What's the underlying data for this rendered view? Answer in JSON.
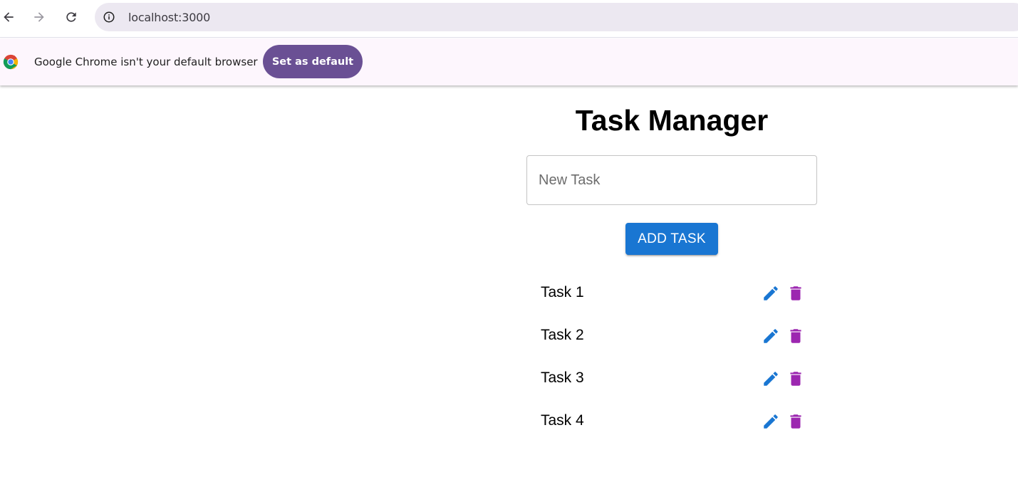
{
  "browser": {
    "url": "localhost:3000",
    "icons": {
      "back": "arrow-left-icon",
      "forward": "arrow-right-icon",
      "reload": "reload-icon",
      "site_info": "info-icon"
    }
  },
  "infobar": {
    "message": "Google Chrome isn't your default browser",
    "button_label": "Set as default",
    "icon": "chrome-logo-icon"
  },
  "app": {
    "title": "Task Manager",
    "input": {
      "placeholder": "New Task",
      "value": ""
    },
    "add_button_label": "ADD TASK",
    "tasks": [
      {
        "label": "Task 1"
      },
      {
        "label": "Task 2"
      },
      {
        "label": "Task 3"
      },
      {
        "label": "Task 4"
      }
    ],
    "icons": {
      "edit": "pencil-icon",
      "delete": "trash-icon"
    },
    "colors": {
      "primary": "#1976d2",
      "secondary": "#9c27b0",
      "infobar_button": "#6a5094"
    }
  }
}
